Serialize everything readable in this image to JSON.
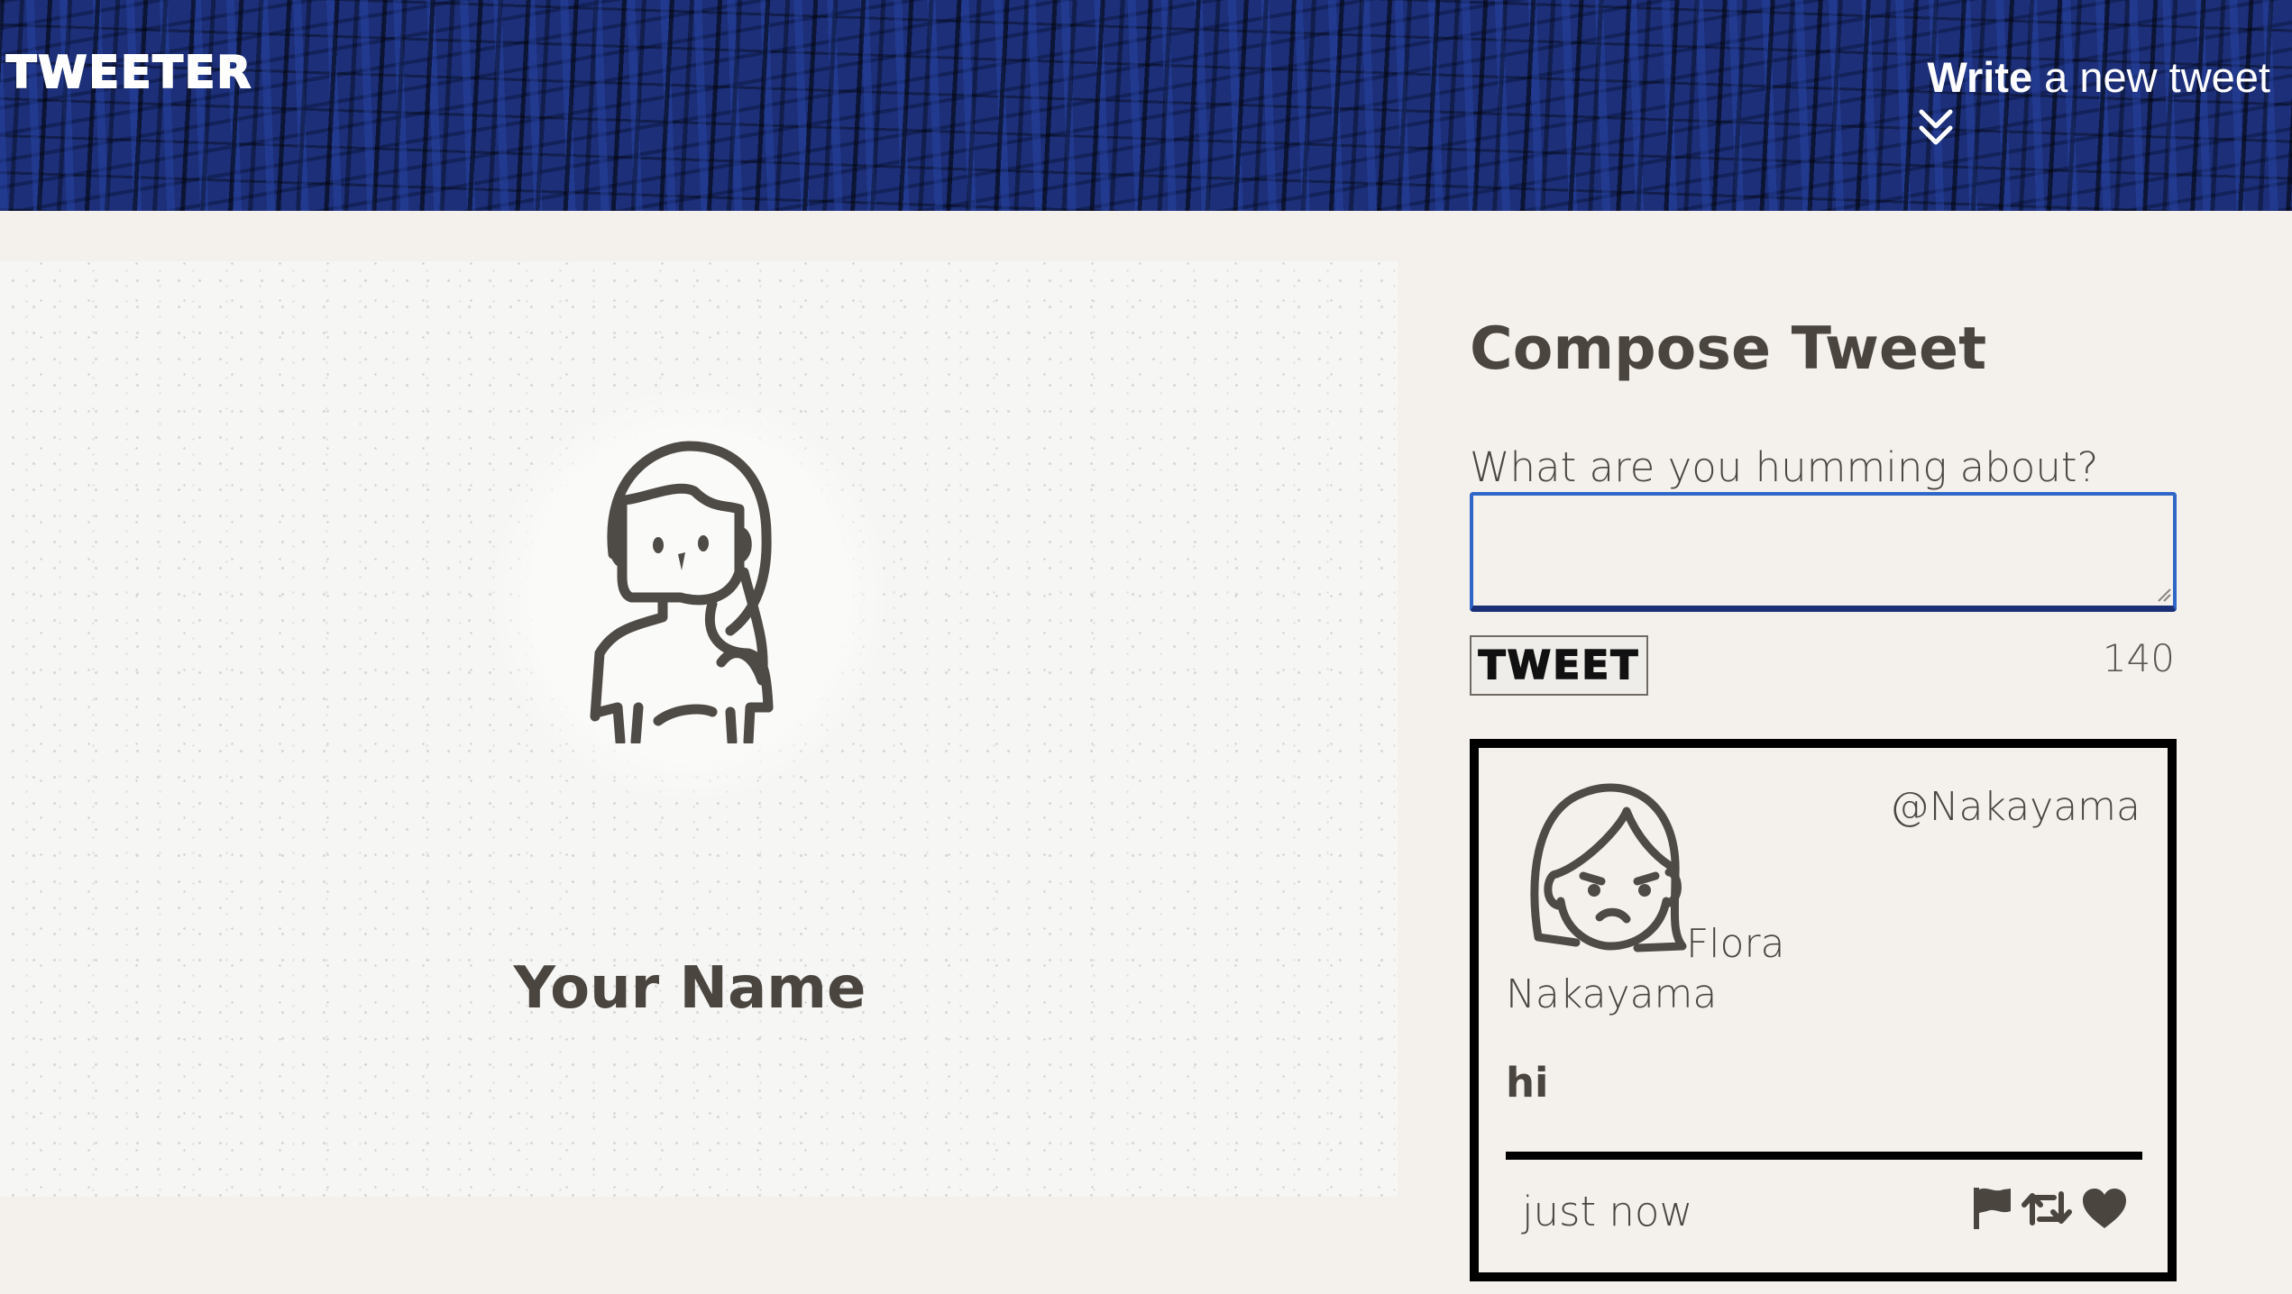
{
  "header": {
    "brand": "TWEETER",
    "write_bold": "Write",
    "write_rest": " a new tweet",
    "toggle_icon": "double-chevron-down-icon"
  },
  "profile": {
    "name": "Your Name",
    "avatar_icon": "person-long-hair-icon"
  },
  "compose": {
    "title": "Compose Tweet",
    "label": "What are you humming about?",
    "input_value": "",
    "button_label": "TWEET",
    "counter": "140"
  },
  "tweets": [
    {
      "handle": "@Nakayama",
      "name": "Flora Nakayama",
      "body": "hi",
      "time": "just now",
      "avatar_icon": "sad-girl-avatar-icon",
      "actions": [
        "flag-icon",
        "retweet-icon",
        "heart-icon"
      ]
    }
  ],
  "colors": {
    "header_blue": "#1c2f78",
    "page_bg": "#f4f1ed",
    "text": "#4a453f",
    "input_focus": "#2f67c8"
  }
}
